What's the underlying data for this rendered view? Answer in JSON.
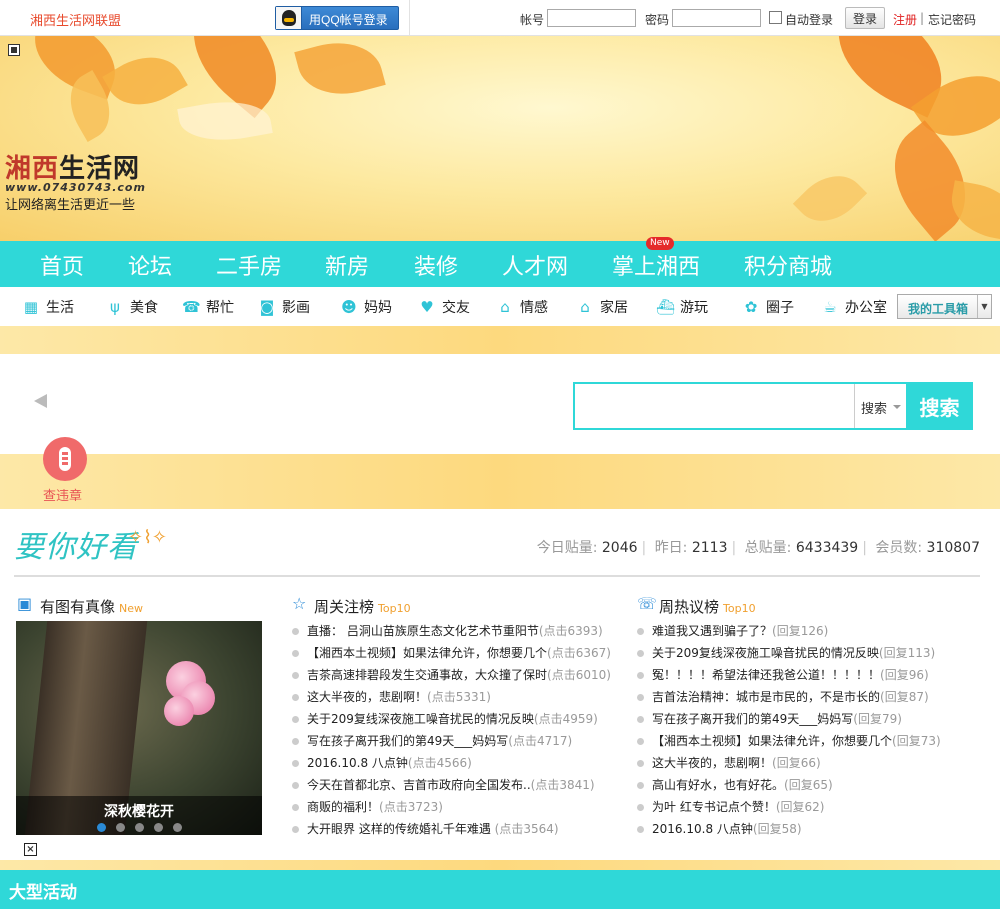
{
  "topbar": {
    "union": "湘西生活网联盟",
    "qq_login": "用QQ帐号登录",
    "account_label": "帐号",
    "password_label": "密码",
    "auto_login": "自动登录",
    "login": "登录",
    "register": "注册",
    "separator": "|",
    "forgot": "忘记密码"
  },
  "banner": {
    "logo_title_red": "湘西",
    "logo_title_rest": "生活网",
    "logo_domain": "www.07430743.com",
    "logo_slogan": "让网络离生活更近一些"
  },
  "main_nav": [
    "首页",
    "论坛",
    "二手房",
    "新房",
    "装修",
    "人才网",
    "掌上湘西",
    "积分商城"
  ],
  "new_badge": "New",
  "sub_nav": [
    {
      "label": "生活",
      "icon": "shop-icon"
    },
    {
      "label": "美食",
      "icon": "fork-knife-icon"
    },
    {
      "label": "帮忙",
      "icon": "help-icon"
    },
    {
      "label": "影画",
      "icon": "camera-icon"
    },
    {
      "label": "妈妈",
      "icon": "mother-icon"
    },
    {
      "label": "交友",
      "icon": "heart-icon"
    },
    {
      "label": "情感",
      "icon": "emotion-icon"
    },
    {
      "label": "家居",
      "icon": "home-icon"
    },
    {
      "label": "游玩",
      "icon": "travel-icon"
    },
    {
      "label": "圈子",
      "icon": "circle-icon"
    },
    {
      "label": "办公室",
      "icon": "office-icon"
    }
  ],
  "toolbox": "我的工具箱",
  "search": {
    "placeholder": "",
    "type": "搜索",
    "button": "搜索"
  },
  "check_violation": "查违章",
  "slogan": "要你好看",
  "stats": [
    {
      "label": "今日贴量:",
      "value": "2046"
    },
    {
      "label": "昨日:",
      "value": "2113"
    },
    {
      "label": "总贴量:",
      "value": "6433439"
    },
    {
      "label": "会员数:",
      "value": "310807"
    }
  ],
  "col1": {
    "title": "有图有真像",
    "badge": "New",
    "caption": "深秋樱花开"
  },
  "col2": {
    "title": "周关注榜",
    "badge": "Top10",
    "items": [
      {
        "text": "直播： 吕洞山苗族原生态文化艺术节重阳节",
        "count": "(点击6393)"
      },
      {
        "text": "【湘西本土视频】如果法律允许，你想要几个",
        "count": "(点击6367)"
      },
      {
        "text": "吉茶高速排碧段发生交通事故，大众撞了保时",
        "count": "(点击6010)"
      },
      {
        "text": "这大半夜的，悲剧啊！",
        "count": "(点击5331)"
      },
      {
        "text": "关于209复线深夜施工噪音扰民的情况反映",
        "count": "(点击4959)"
      },
      {
        "text": "写在孩子离开我们的第49天___妈妈写",
        "count": "(点击4717)"
      },
      {
        "text": "2016.10.8 八点钟",
        "count": "(点击4566)"
      },
      {
        "text": "今天在首都北京、吉首市政府向全国发布..",
        "count": "(点击3841)"
      },
      {
        "text": "商贩的福利！",
        "count": "(点击3723)"
      },
      {
        "text": "大开眼界 这样的传统婚礼千年难遇",
        "count": " (点击3564)"
      }
    ]
  },
  "col3": {
    "title": "周热议榜",
    "badge": "Top10",
    "items": [
      {
        "text": "难道我又遇到骗子了？",
        "count": "(回复126)"
      },
      {
        "text": "关于209复线深夜施工噪音扰民的情况反映",
        "count": "(回复113)"
      },
      {
        "text": "冤！！！！希望法律还我爸公道！！！！！",
        "count": "(回复96)"
      },
      {
        "text": "吉首法治精神：城市是市民的，不是市长的",
        "count": "(回复87)"
      },
      {
        "text": "写在孩子离开我们的第49天___妈妈写",
        "count": "(回复79)"
      },
      {
        "text": "【湘西本土视频】如果法律允许，你想要几个",
        "count": "(回复73)"
      },
      {
        "text": "这大半夜的，悲剧啊！",
        "count": "(回复66)"
      },
      {
        "text": "高山有好水，也有好花。",
        "count": "(回复65)"
      },
      {
        "text": "为叶 红专书记点个赞！",
        "count": "(回复62)"
      },
      {
        "text": "2016.10.8 八点钟",
        "count": "(回复58)"
      }
    ]
  },
  "big_activity": "大型活动",
  "colors": {
    "accent": "#2fd8d8",
    "brand_red": "#e84a2c",
    "band_yellow": "#fdd97e"
  }
}
